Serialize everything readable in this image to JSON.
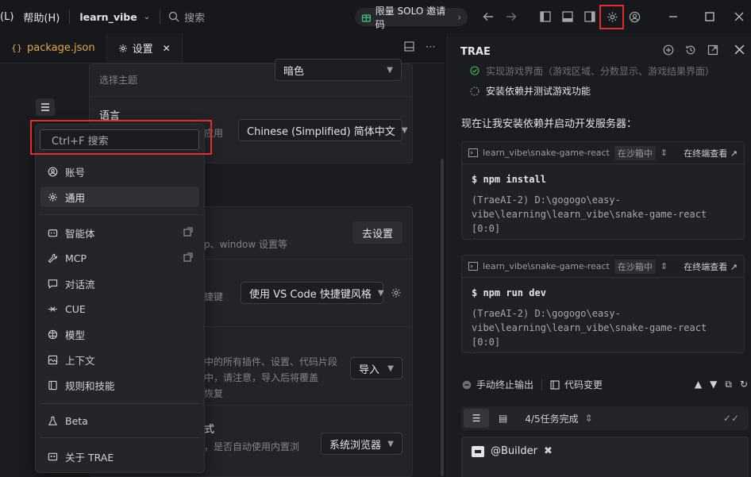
{
  "titlebar": {
    "menu_partial": "(L)",
    "help_menu": "帮助(H)",
    "project": "learn_vibe",
    "search_placeholder": "搜索",
    "promo_label": "限量 SOLO 邀请码"
  },
  "tabs": [
    {
      "label": "package.json"
    },
    {
      "label": "设置"
    }
  ],
  "settings": {
    "theme_desc": "选择主题",
    "theme_value": "暗色",
    "language_label": "语言",
    "language_desc_partial": "应用",
    "language_value": "Chinese (Simplified) 简体中文",
    "import_desc_partial": "p、window 设置等",
    "import_button": "去设置",
    "keymap_desc_partial": "捷键",
    "keymap_value": "使用 VS Code 快捷键风格",
    "migrate_line1": "中的所有插件、设置、代码片段",
    "migrate_line2": "中，请注意，导入后将覆盖",
    "migrate_line3": "恢复",
    "migrate_button": "导入",
    "browser_label_partial": "式",
    "browser_desc_partial": "，是否自动使用内置浏",
    "browser_value": "系统浏览器"
  },
  "menu": {
    "search_placeholder": "Ctrl+F 搜索",
    "items": [
      {
        "label": "账号"
      },
      {
        "label": "通用"
      },
      {
        "label": "智能体"
      },
      {
        "label": "MCP"
      },
      {
        "label": "对话流"
      },
      {
        "label": "CUE"
      },
      {
        "label": "模型"
      },
      {
        "label": "上下文"
      },
      {
        "label": "规则和技能"
      },
      {
        "label": "Beta"
      },
      {
        "label": "关于 TRAE"
      }
    ]
  },
  "panel": {
    "title": "TRAE",
    "task_done_partial": "实现游戏界面（游戏区域、分数显示、游戏结果界面）",
    "task_pending": "安装依赖并测试游戏功能",
    "message": "现在让我安装依赖并启动开发服务器：",
    "terminals": [
      {
        "path": "learn_vibe\\snake-game-react",
        "sandbox": "在沙箱中",
        "view": "在终端查看",
        "command": "npm install",
        "output_1": "(TraeAI-2) D:\\gogogo\\easy-",
        "output_2": "vibe\\learning\\learn_vibe\\snake-game-react [0:0]",
        "output_3": "$"
      },
      {
        "path": "learn_vibe\\snake-game-react",
        "sandbox": "在沙箱中",
        "view": "在终端查看",
        "command": "npm run dev",
        "output_1": "(TraeAI-2) D:\\gogogo\\easy-",
        "output_2": "vibe\\learning\\learn_vibe\\snake-game-react [0:0]",
        "output_3": "$"
      }
    ],
    "stop_output": "手动终止输出",
    "code_changes": "代码变更",
    "progress": "4/5任务完成",
    "builder": "@Builder"
  },
  "colors": {
    "highlight": "#e52b2b",
    "promo_icon": "#3fbf6a",
    "json_tab": "#e0a84a"
  }
}
